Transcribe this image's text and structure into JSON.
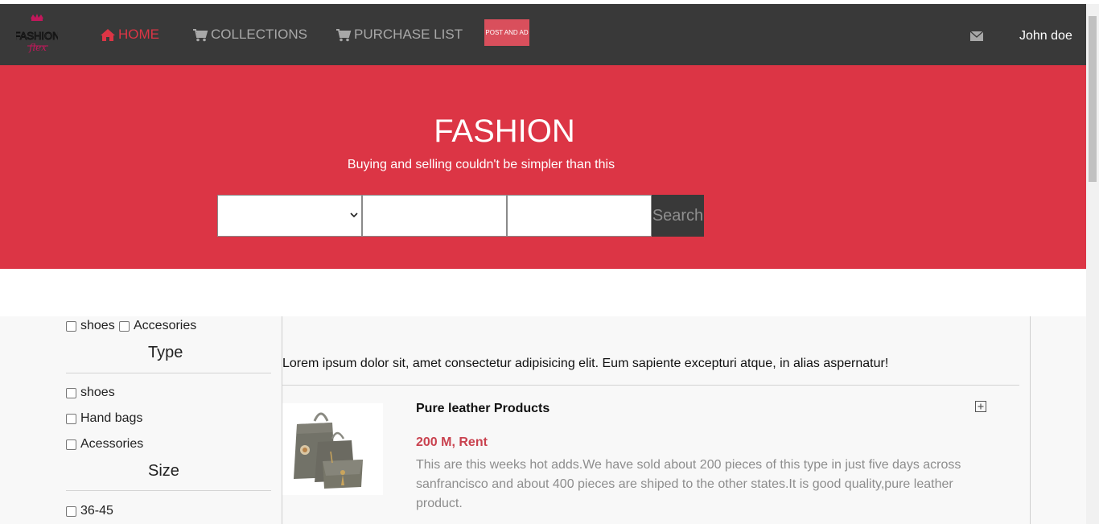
{
  "nav": {
    "logo_text_top": "FASHION",
    "logo_text_bottom": "flex",
    "home_label": "HOME",
    "collections_label": "COLLECTIONS",
    "purchase_label": "PURCHASE LIST",
    "post_ad_label": "POST AND AD",
    "mail_icon": "envelope-icon",
    "user_name": "John doe"
  },
  "hero": {
    "title": "FASHION",
    "subtitle": "Buying and selling couldn't be simpler than this",
    "select_value": "",
    "input_one_value": "",
    "input_two_value": "",
    "search_label": "Search"
  },
  "filters": {
    "top_options": [
      "shoes",
      "Accesories"
    ],
    "type_heading": "Type",
    "type_options": [
      "shoes",
      "Hand bags",
      "Acessories"
    ],
    "size_heading": "Size",
    "size_options": [
      "36-45"
    ]
  },
  "main": {
    "intro": "Lorem ipsum dolor sit, amet consectetur adipisicing elit. Eum sapiente excepturi atque, in alias aspernatur!",
    "product": {
      "title": "Pure leather Products",
      "price": "200 M, Rent",
      "description": "This are this weeks hot adds.We have sold about 200 pieces of this type in just five days across sanfrancisco and about 400 pieces are shiped to the other states.It is good quality,pure leather product.",
      "image": "handbag-set-image",
      "expand_icon": "plus-square-icon"
    }
  },
  "colors": {
    "navbar": "#393939",
    "accent": "#dc3545",
    "post_ad": "#d94f5c",
    "price": "#c9424f"
  }
}
